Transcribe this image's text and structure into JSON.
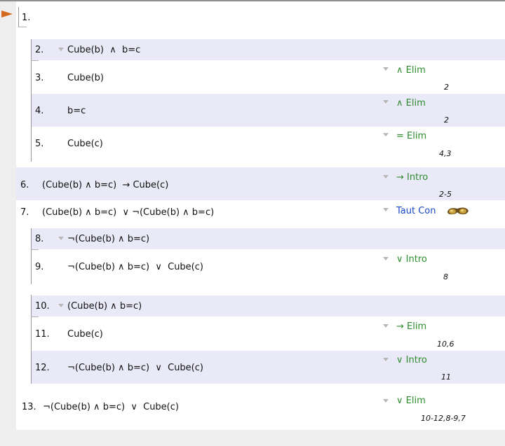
{
  "steps": [
    {
      "n": "1.",
      "s": ""
    },
    {
      "n": "2.",
      "s": "Cube(b)  ∧  b=c"
    },
    {
      "n": "3.",
      "s": "Cube(b)",
      "rule": "∧ Elim",
      "cite": "2"
    },
    {
      "n": "4.",
      "s": "b=c",
      "rule": "∧ Elim",
      "cite": "2"
    },
    {
      "n": "5.",
      "s": "Cube(c)",
      "rule": "= Elim",
      "cite": "4,3"
    },
    {
      "n": "6.",
      "s": "(Cube(b) ∧ b=c)  → Cube(c)",
      "rule": "→ Intro",
      "cite": "2-5"
    },
    {
      "n": "7.",
      "s": "(Cube(b) ∧ b=c)  ∨ ¬(Cube(b) ∧ b=c)",
      "rule": "Taut Con",
      "cite": ""
    },
    {
      "n": "8.",
      "s": "¬(Cube(b) ∧ b=c)"
    },
    {
      "n": "9.",
      "s": "¬(Cube(b) ∧ b=c)  ∨  Cube(c)",
      "rule": "∨ Intro",
      "cite": "8"
    },
    {
      "n": "10.",
      "s": "(Cube(b) ∧ b=c)"
    },
    {
      "n": "11.",
      "s": "Cube(c)",
      "rule": "→ Elim",
      "cite": "10,6"
    },
    {
      "n": "12.",
      "s": "¬(Cube(b) ∧ b=c)  ∨  Cube(c)",
      "rule": "∨ Intro",
      "cite": "11"
    },
    {
      "n": "13.",
      "s": "¬(Cube(b) ∧ b=c)  ∨  Cube(c)",
      "rule": "∨ Elim",
      "cite": "10-12,8-9,7"
    }
  ],
  "icons": {
    "focus": "focus-arrow-icon",
    "menu": "rule-menu-triangle-icon",
    "taut": "goggles-icon"
  },
  "colors": {
    "rule": "#2e8b2e",
    "taut_rule": "#1b48c8",
    "highlight": "#e9e9f7",
    "focus": "#d2691e"
  }
}
